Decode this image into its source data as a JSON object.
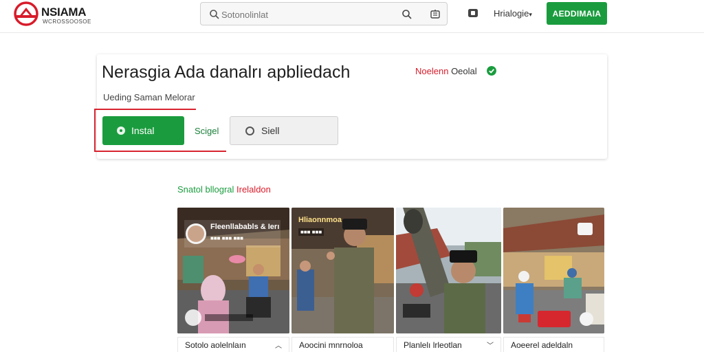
{
  "header": {
    "logo_title": "NSIAMA",
    "logo_subtitle": "WCROSSOOSOE",
    "search_placeholder": "Sotonolinlat",
    "language": "Hrialogie",
    "cta_label": "AEDDIMAIA",
    "icons": [
      "search-icon",
      "keyboard-icon",
      "notification-icon"
    ]
  },
  "app": {
    "title": "Nerasgia Ada danalrı apbliedach",
    "publisher_a": "Noelenn",
    "publisher_b": "Oeolal",
    "subtitle": "Ueding Saman Melorar",
    "install_label": "Instal",
    "secondary_link": "Scigel",
    "share_label": "Siell"
  },
  "section": {
    "title_a": "Snatol bllogral",
    "title_b": "Irelaldon"
  },
  "gallery": {
    "items": [
      {
        "caption": "Sotolo aolelnlaın",
        "overlay": "Fleenllababls & Ierı",
        "overlay_sub": "■■■ ■■■ ■■■"
      },
      {
        "caption": "Aoocini mnrnoloa",
        "overlay": "Hliaonnmoa",
        "overlay_sub": "■■■ ■■■"
      },
      {
        "caption": "Planlelı lrleotlan",
        "overlay": "",
        "overlay_sub": ""
      },
      {
        "caption": "Aoeerel adeldaln",
        "overlay": "",
        "overlay_sub": ""
      }
    ]
  },
  "colors": {
    "accent_green": "#1a9c3e",
    "accent_red": "#d81b2a"
  }
}
